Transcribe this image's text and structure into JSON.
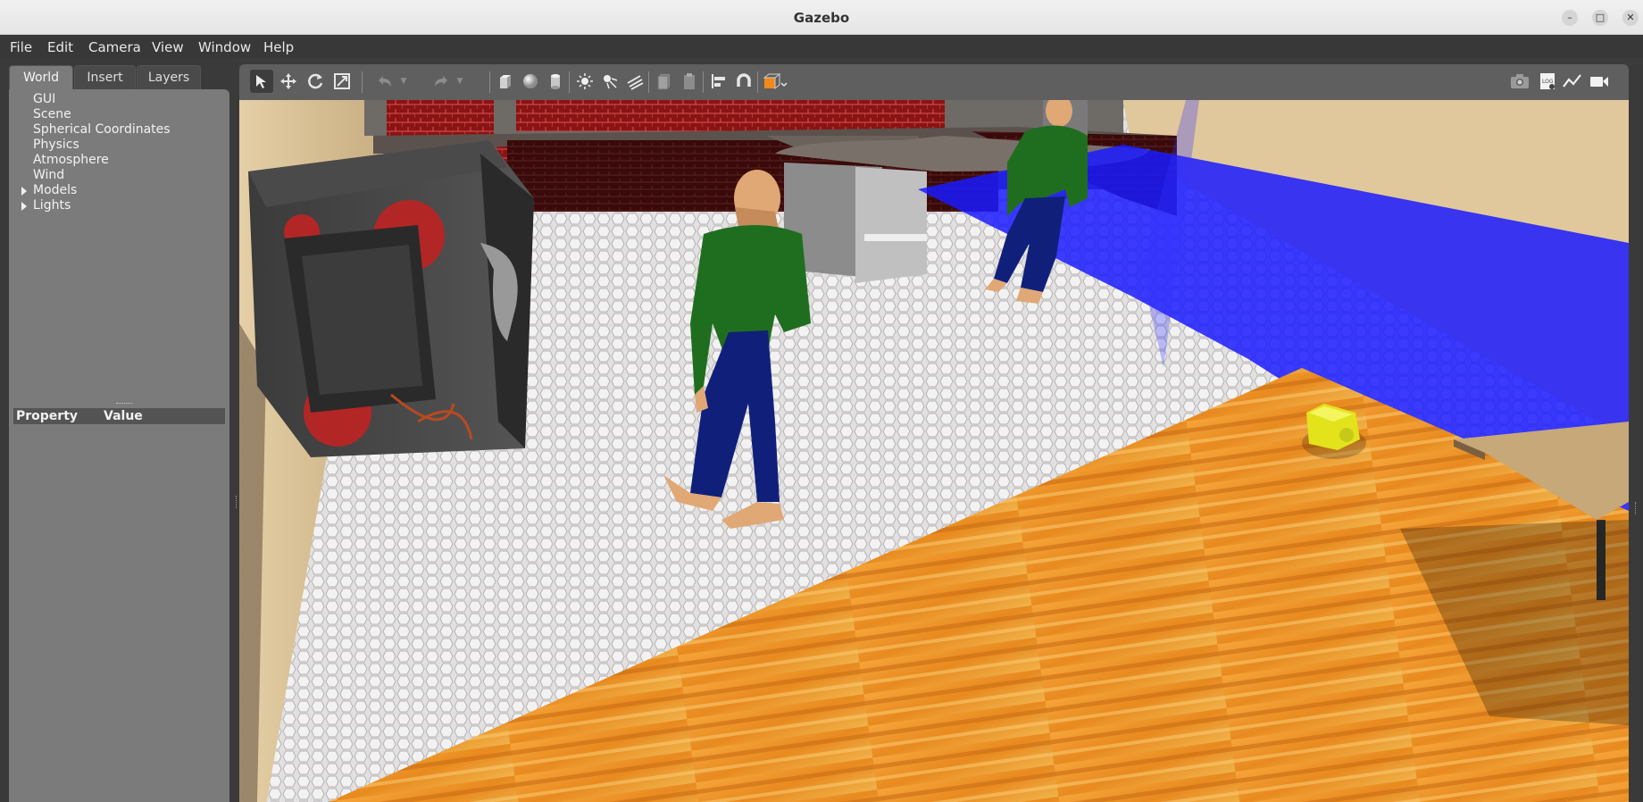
{
  "window": {
    "title": "Gazebo",
    "controls": [
      "–",
      "□",
      "✕"
    ]
  },
  "menu": [
    "File",
    "Edit",
    "Camera",
    "View",
    "Window",
    "Help"
  ],
  "tabs": [
    "World",
    "Insert",
    "Layers"
  ],
  "world_tree": [
    "GUI",
    "Scene",
    "Spherical Coordinates",
    "Physics",
    "Atmosphere",
    "Wind",
    "Models",
    "Lights"
  ],
  "property_table": {
    "col_property": "Property",
    "col_value": "Value"
  },
  "toolbar": {
    "tools": [
      "select-mode-icon",
      "translate-icon",
      "rotate-icon",
      "scale-icon",
      "undo-icon",
      "redo-icon",
      "box-icon",
      "sphere-icon",
      "cylinder-icon",
      "point-light-icon",
      "spot-light-icon",
      "directional-light-icon",
      "copy-icon",
      "paste-icon",
      "align-icon",
      "snap-icon",
      "view-angle-icon"
    ],
    "right_tools": [
      "screenshot-icon",
      "log-icon",
      "plot-icon",
      "video-icon"
    ],
    "log_label": "LOG"
  },
  "colors": {
    "accent": "#f08a1c",
    "panel": "#7b7b7b",
    "laser": "#1a1aff",
    "floor_wood": "#e8912a",
    "shirt": "#1f6e1f",
    "pants": "#10207a"
  }
}
